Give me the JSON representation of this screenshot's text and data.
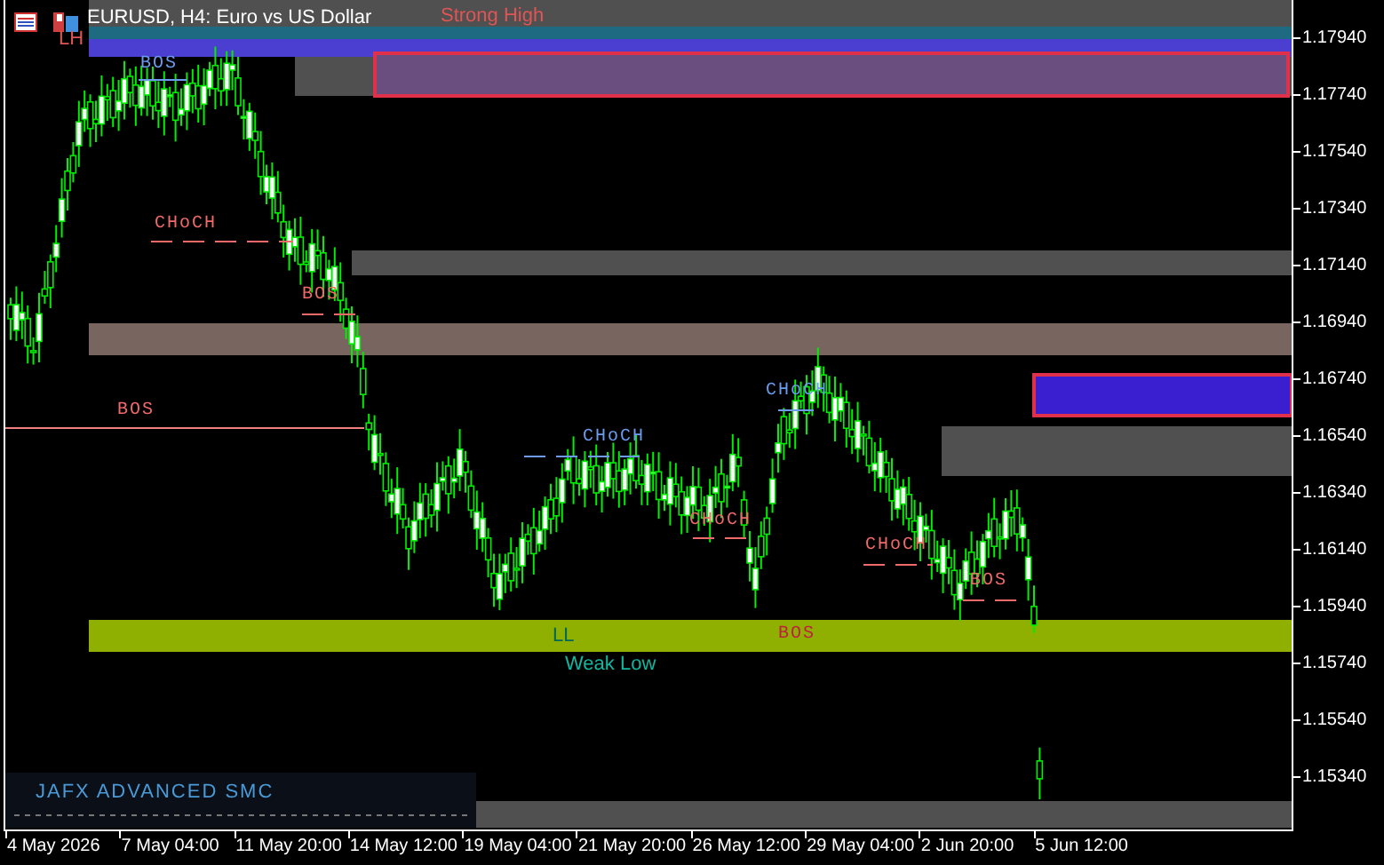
{
  "window": {
    "title": "EURUSD, H4:  Euro vs US Dollar"
  },
  "annotations": [
    {
      "text": "Strong High",
      "kind": "swing",
      "color": "#e05555"
    },
    {
      "text": "LH",
      "kind": "swing",
      "color": "#e05555"
    },
    {
      "text": "BOS",
      "kind": "structure",
      "color": "#6c9cf0"
    },
    {
      "text": "CHoCH",
      "kind": "structure",
      "color": "#f06a6a"
    },
    {
      "text": "BOS",
      "kind": "structure",
      "color": "#f06a6a"
    },
    {
      "text": "BOS",
      "kind": "structure",
      "color": "#f06a6a"
    },
    {
      "text": "CHoCH",
      "kind": "structure",
      "color": "#6c9cf0"
    },
    {
      "text": "CHoCH",
      "kind": "structure",
      "color": "#6c9cf0"
    },
    {
      "text": "CHoCH",
      "kind": "structure",
      "color": "#f06a6a"
    },
    {
      "text": "CHoCH",
      "kind": "structure",
      "color": "#f06a6a"
    },
    {
      "text": "BOS",
      "kind": "structure",
      "color": "#f06a6a"
    },
    {
      "text": "LL",
      "kind": "swing",
      "color": "#006858"
    },
    {
      "text": "BOS",
      "kind": "structure",
      "color": "#c02040"
    },
    {
      "text": "Weak Low",
      "kind": "swing",
      "color": "#10b8a0"
    }
  ],
  "indicator_label": "JAFX ADVANCED SMC",
  "price_axis": [
    "1.17940",
    "1.17740",
    "1.17540",
    "1.17340",
    "1.17140",
    "1.16940",
    "1.16740",
    "1.16540",
    "1.16340",
    "1.16140",
    "1.15940",
    "1.15740",
    "1.15540",
    "1.15340"
  ],
  "time_axis": [
    "4 May 2026",
    "7 May 04:00",
    "11 May 20:00",
    "14 May 12:00",
    "19 May 04:00",
    "21 May 20:00",
    "26 May 12:00",
    "29 May 04:00",
    "2 Jun 20:00",
    "5 Jun 12:00"
  ]
}
